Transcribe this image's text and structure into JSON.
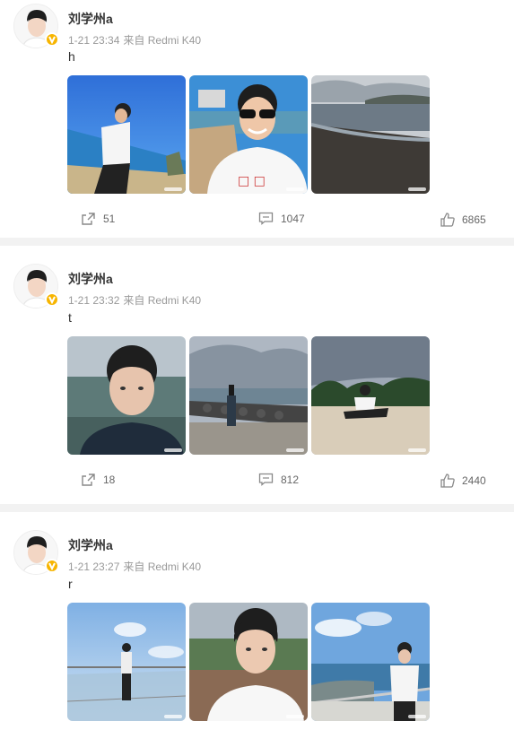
{
  "feed": {
    "posts": [
      {
        "author": "刘学州a",
        "time": "1-21 23:34",
        "source": "来自 Redmi K40",
        "text": "h",
        "shares": "51",
        "comments": "1047",
        "likes": "6865"
      },
      {
        "author": "刘学州a",
        "time": "1-21 23:32",
        "source": "来自 Redmi K40",
        "text": "t",
        "shares": "18",
        "comments": "812",
        "likes": "2440"
      },
      {
        "author": "刘学州a",
        "time": "1-21 23:27",
        "source": "来自 Redmi K40",
        "text": "r"
      }
    ]
  },
  "icons": {
    "share": "share-icon",
    "comment": "comment-icon",
    "like": "like-icon",
    "verified": "verified-badge-icon"
  },
  "colors": {
    "verified_badge": "#f7b500",
    "meta_text": "#999999",
    "divider": "#f2f2f2"
  }
}
